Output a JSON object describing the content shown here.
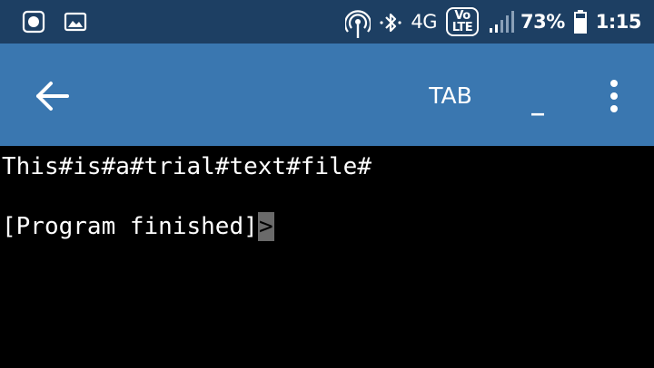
{
  "status_bar": {
    "left_icons": [
      "screenshot-icon",
      "image-icon"
    ],
    "right_icons": [
      "hotspot-icon",
      "bluetooth-icon",
      "network-icon",
      "volte-icon",
      "signal-icon",
      "battery-icon"
    ],
    "network": "4G",
    "volte": "Vo LTE",
    "battery": "73%",
    "time": "1:15"
  },
  "toolbar": {
    "tab_label": "TAB",
    "underscore_label": "_",
    "accent_color": "#3a77b0",
    "status_color": "#1d3f63"
  },
  "terminal": {
    "lines": [
      "This#is#a#trial#text#file#",
      "[Program finished]"
    ],
    "cursor_char": ">"
  }
}
